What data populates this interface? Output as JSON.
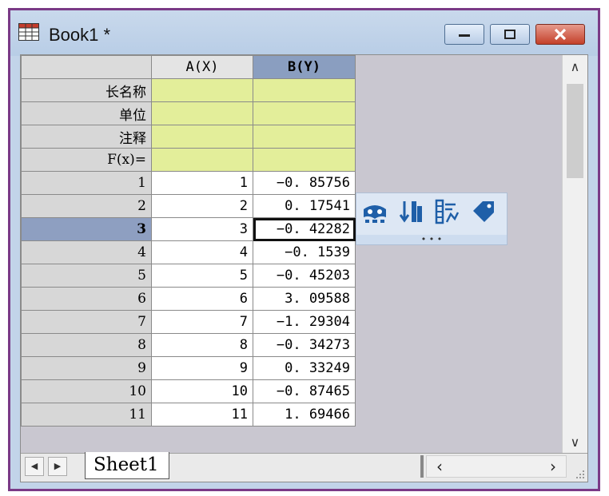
{
  "window": {
    "title": "Book1 *",
    "controls": {
      "minimize": "minimize",
      "maximize": "maximize",
      "close": "close"
    }
  },
  "columns": [
    {
      "label": "A(X)"
    },
    {
      "label": "B(Y)"
    }
  ],
  "meta_rows": [
    {
      "label": "长名称"
    },
    {
      "label": "单位"
    },
    {
      "label": "注释"
    },
    {
      "label": "F(x)="
    }
  ],
  "rows": [
    {
      "row": "1",
      "a": "1",
      "b": "−0. 85756"
    },
    {
      "row": "2",
      "a": "2",
      "b": "0. 17541"
    },
    {
      "row": "3",
      "a": "3",
      "b": "−0. 42282"
    },
    {
      "row": "4",
      "a": "4",
      "b": "−0. 1539"
    },
    {
      "row": "5",
      "a": "5",
      "b": "−0. 45203"
    },
    {
      "row": "6",
      "a": "6",
      "b": "3. 09588"
    },
    {
      "row": "7",
      "a": "7",
      "b": "−1. 29304"
    },
    {
      "row": "8",
      "a": "8",
      "b": "−0. 34273"
    },
    {
      "row": "9",
      "a": "9",
      "b": "0. 33249"
    },
    {
      "row": "10",
      "a": "10",
      "b": "−0. 87465"
    },
    {
      "row": "11",
      "a": "11",
      "b": "1. 69466"
    }
  ],
  "selected_row": 3,
  "sheet_tab": "Sheet1",
  "popup_icons": [
    "mask-icon",
    "sort-icon",
    "column-properties-icon",
    "tag-icon"
  ],
  "popup_dots": "• • •",
  "colors": {
    "window_border": "#7a3a86",
    "selected_column": "#8a9ec0",
    "meta_rows": "#e3ee9a",
    "close_button": "#c4402a"
  }
}
